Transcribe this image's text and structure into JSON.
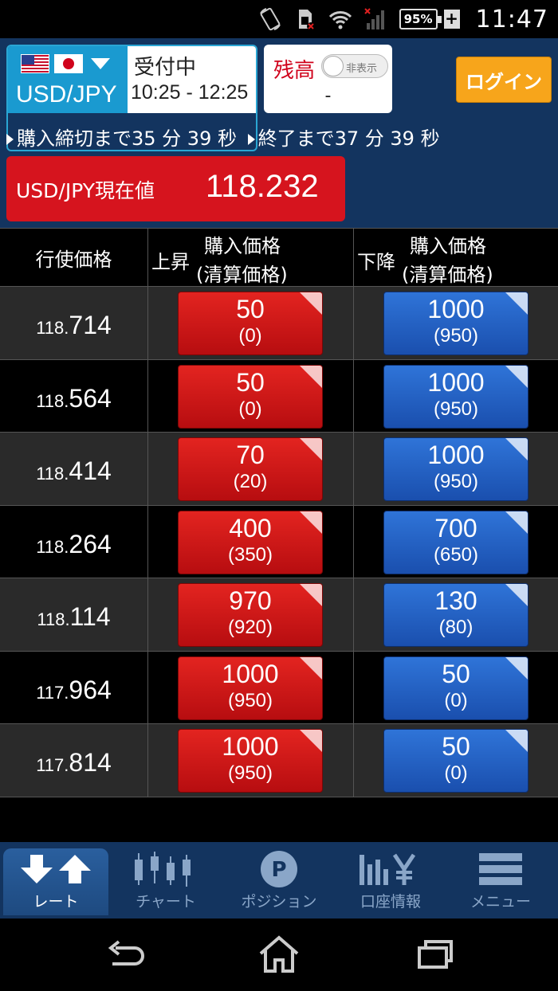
{
  "statusbar": {
    "battery_percent": "95%",
    "battery_plus": "+",
    "time": "11:47",
    "icons": [
      "rotation-lock-icon",
      "sim-card-icon",
      "wifi-icon",
      "signal-icon"
    ]
  },
  "header": {
    "pair": "USD/JPY",
    "flags": [
      "us-flag-icon",
      "jp-flag-icon"
    ],
    "status": "受付中",
    "hours": "10:25 - 12:25",
    "balance_label": "残高",
    "toggle_label": "非表示",
    "balance_value": "-",
    "login_label": "ログイン",
    "countdown_purchase": "購入締切まで35 分 39 秒",
    "countdown_end": "終了まで37 分 39 秒",
    "price_label": "USD/JPY現在値",
    "price_value": "118.232"
  },
  "table": {
    "col_strike": "行使価格",
    "col_up_dir": "上昇",
    "col_down_dir": "下降",
    "col_price_l1": "購入価格",
    "col_price_l2": "(清算価格)",
    "rows": [
      {
        "strike_prefix": "118.",
        "strike_main": "714",
        "up_price": "50",
        "up_settle": "(0)",
        "down_price": "1000",
        "down_settle": "(950)"
      },
      {
        "strike_prefix": "118.",
        "strike_main": "564",
        "up_price": "50",
        "up_settle": "(0)",
        "down_price": "1000",
        "down_settle": "(950)"
      },
      {
        "strike_prefix": "118.",
        "strike_main": "414",
        "up_price": "70",
        "up_settle": "(20)",
        "down_price": "1000",
        "down_settle": "(950)"
      },
      {
        "strike_prefix": "118.",
        "strike_main": "264",
        "up_price": "400",
        "up_settle": "(350)",
        "down_price": "700",
        "down_settle": "(650)"
      },
      {
        "strike_prefix": "118.",
        "strike_main": "114",
        "up_price": "970",
        "up_settle": "(920)",
        "down_price": "130",
        "down_settle": "(80)"
      },
      {
        "strike_prefix": "117.",
        "strike_main": "964",
        "up_price": "1000",
        "up_settle": "(950)",
        "down_price": "50",
        "down_settle": "(0)"
      },
      {
        "strike_prefix": "117.",
        "strike_main": "814",
        "up_price": "1000",
        "up_settle": "(950)",
        "down_price": "50",
        "down_settle": "(0)"
      }
    ]
  },
  "nav": {
    "items": [
      {
        "label": "レート",
        "icon": "rate-arrows-icon"
      },
      {
        "label": "チャート",
        "icon": "candlestick-chart-icon"
      },
      {
        "label": "ポジション",
        "icon": "position-p-icon"
      },
      {
        "label": "口座情報",
        "icon": "account-yen-icon"
      },
      {
        "label": "メニュー",
        "icon": "menu-icon"
      }
    ]
  },
  "colors": {
    "header_bg": "#13345f",
    "price_red": "#d6141e",
    "login_orange": "#f7a51b",
    "up_button": "#d01a1a",
    "down_button": "#2563c8"
  }
}
